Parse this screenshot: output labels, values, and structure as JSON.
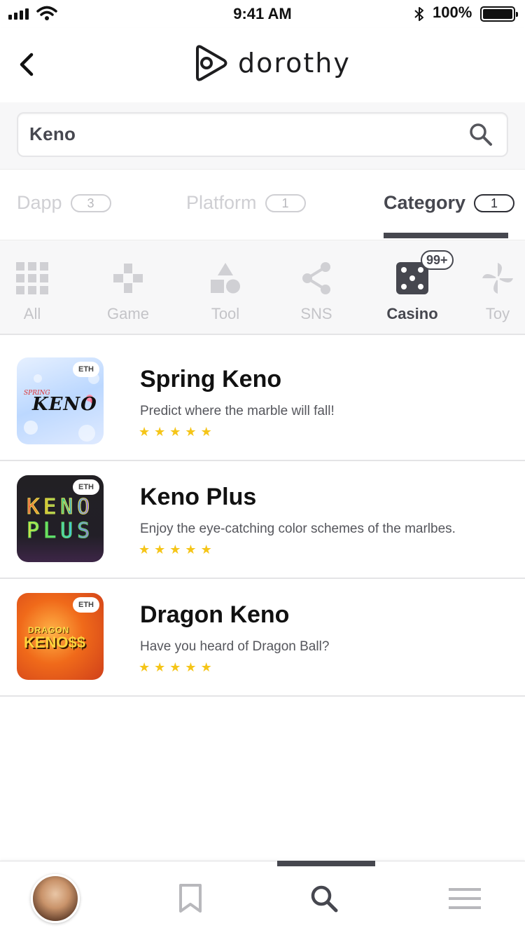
{
  "status_bar": {
    "time": "9:41 AM",
    "battery": "100%"
  },
  "header": {
    "brand": "dorothy",
    "back_icon": "chevron-left-icon",
    "logo_icon": "dorothy-play-logo"
  },
  "search": {
    "value": "Keno",
    "icon": "search-icon"
  },
  "filter_tabs": [
    {
      "label": "Dapp",
      "count": "3",
      "active": false
    },
    {
      "label": "Platform",
      "count": "1",
      "active": false
    },
    {
      "label": "Category",
      "count": "1",
      "active": true
    }
  ],
  "categories": [
    {
      "label": "All",
      "icon": "grid-icon",
      "active": false
    },
    {
      "label": "Game",
      "icon": "gamepad-icon",
      "active": false
    },
    {
      "label": "Tool",
      "icon": "shapes-icon",
      "active": false
    },
    {
      "label": "SNS",
      "icon": "share-icon",
      "active": false
    },
    {
      "label": "Casino",
      "icon": "dice-icon",
      "active": true,
      "badge": "99+"
    },
    {
      "label": "Toy",
      "icon": "pinwheel-icon",
      "active": false
    }
  ],
  "apps": [
    {
      "title": "Spring Keno",
      "description": "Predict where the marble will fall!",
      "chain": "ETH",
      "rating": 5,
      "thumb_text": "KENO",
      "thumb_subtext": "SPRING"
    },
    {
      "title": "Keno Plus",
      "description": "Enjoy the eye-catching color schemes of the marlbes.",
      "chain": "ETH",
      "rating": 5,
      "thumb_text": "KENO",
      "thumb_subtext": "PLUS"
    },
    {
      "title": "Dragon Keno",
      "description": "Have you heard of Dragon Ball?",
      "chain": "ETH",
      "rating": 5,
      "thumb_text": "KENO$$",
      "thumb_subtext": "DRAGON"
    }
  ],
  "bottom_nav": [
    {
      "name": "profile",
      "icon": "avatar"
    },
    {
      "name": "bookmarks",
      "icon": "bookmark-icon"
    },
    {
      "name": "search",
      "icon": "search-icon",
      "active": true
    },
    {
      "name": "menu",
      "icon": "hamburger-menu-icon"
    }
  ],
  "colors": {
    "accent": "#46474f",
    "star": "#f5c518",
    "inactive": "#cfcfd3"
  }
}
